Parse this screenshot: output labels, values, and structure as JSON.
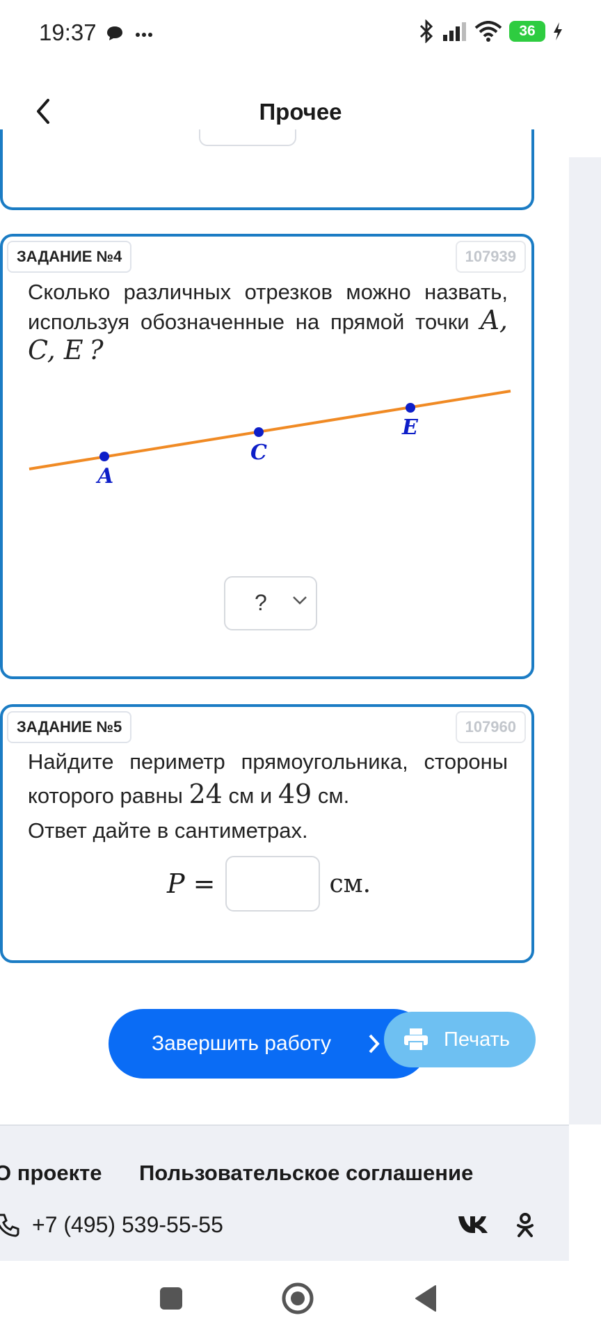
{
  "status_bar": {
    "time": "19:37",
    "battery": "36"
  },
  "header": {
    "title": "Прочее"
  },
  "task4": {
    "badge": "ЗАДАНИЕ №4",
    "id": "107939",
    "text_before": "Сколько различных отрезков можно назвать, используя обозначенные на прямой точки",
    "math_points": "A, C, E",
    "text_after": "?",
    "point_labels": [
      "A",
      "C",
      "E"
    ],
    "answer_value": "?"
  },
  "task5": {
    "badge": "ЗАДАНИЕ №5",
    "id": "107960",
    "text_1": "Найдите периметр прямоугольника, стороны которого равны",
    "side_a": "24",
    "unit_mid": "см и",
    "side_b": "49",
    "unit_end": "см.",
    "text_2": "Ответ дайте в сантиметрах.",
    "formula_label": "P =",
    "answer_unit": "см."
  },
  "actions": {
    "finish_label": "Завершить работу",
    "print_label": "Печать"
  },
  "footer": {
    "about": "О проекте",
    "agreement": "Пользовательское соглашение",
    "phone": "+7 (495) 539-55-55"
  },
  "colors": {
    "accent": "#0a6cf5",
    "card_border": "#1b7cc4",
    "line": "#f08a24",
    "point": "#0d1ec8"
  }
}
